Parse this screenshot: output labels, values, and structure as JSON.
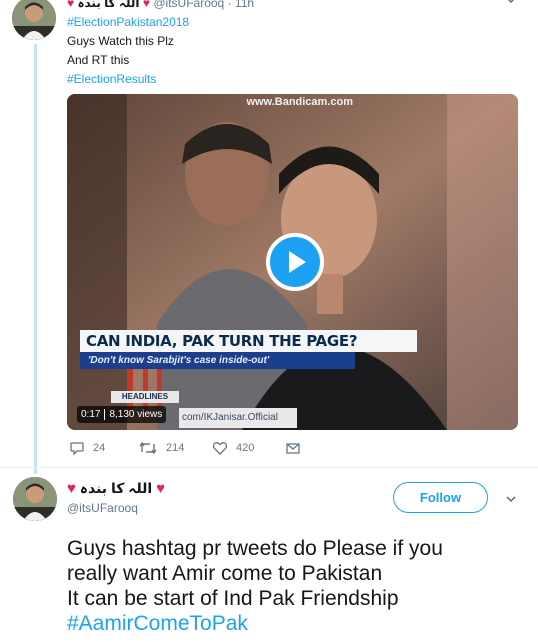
{
  "tweet1": {
    "display_name": "اللہ کا بندہ",
    "handle": "@itsUFarooq",
    "time": "11h",
    "lines": [
      "#ElectionPakistan2018",
      "Guys Watch this Plz",
      "And RT this",
      "#ElectionResults"
    ],
    "video": {
      "watermark": "www.Bandicam.com",
      "banner_main": "CAN INDIA, PAK TURN THE PAGE?",
      "banner_sub": "'Don't know Sarabjit's case inside-out'",
      "headlines": "HEADLINES",
      "overlay_handle": "com/IKJanisar.Official",
      "duration": "0:17",
      "views": "8,130 views"
    },
    "actions": {
      "replies": "24",
      "retweets": "214",
      "likes": "420"
    }
  },
  "tweet2": {
    "display_name": "اللہ کا بندہ",
    "handle": "@itsUFarooq",
    "follow_label": "Follow",
    "body_lines": [
      "Guys hashtag pr tweets do Please if you",
      "really want Amir come to Pakistan",
      "It can be start of Ind Pak Friendship"
    ],
    "hashtag": "#AamirComeToPak"
  },
  "colors": {
    "accent": "#1da1f2",
    "heart": "#e0245e",
    "muted": "#657786",
    "thread": "#c4e3f7"
  },
  "icons": [
    "reply-icon",
    "retweet-icon",
    "like-icon",
    "message-icon",
    "chevron-down-icon",
    "play-icon",
    "heart-emoji-icon"
  ]
}
